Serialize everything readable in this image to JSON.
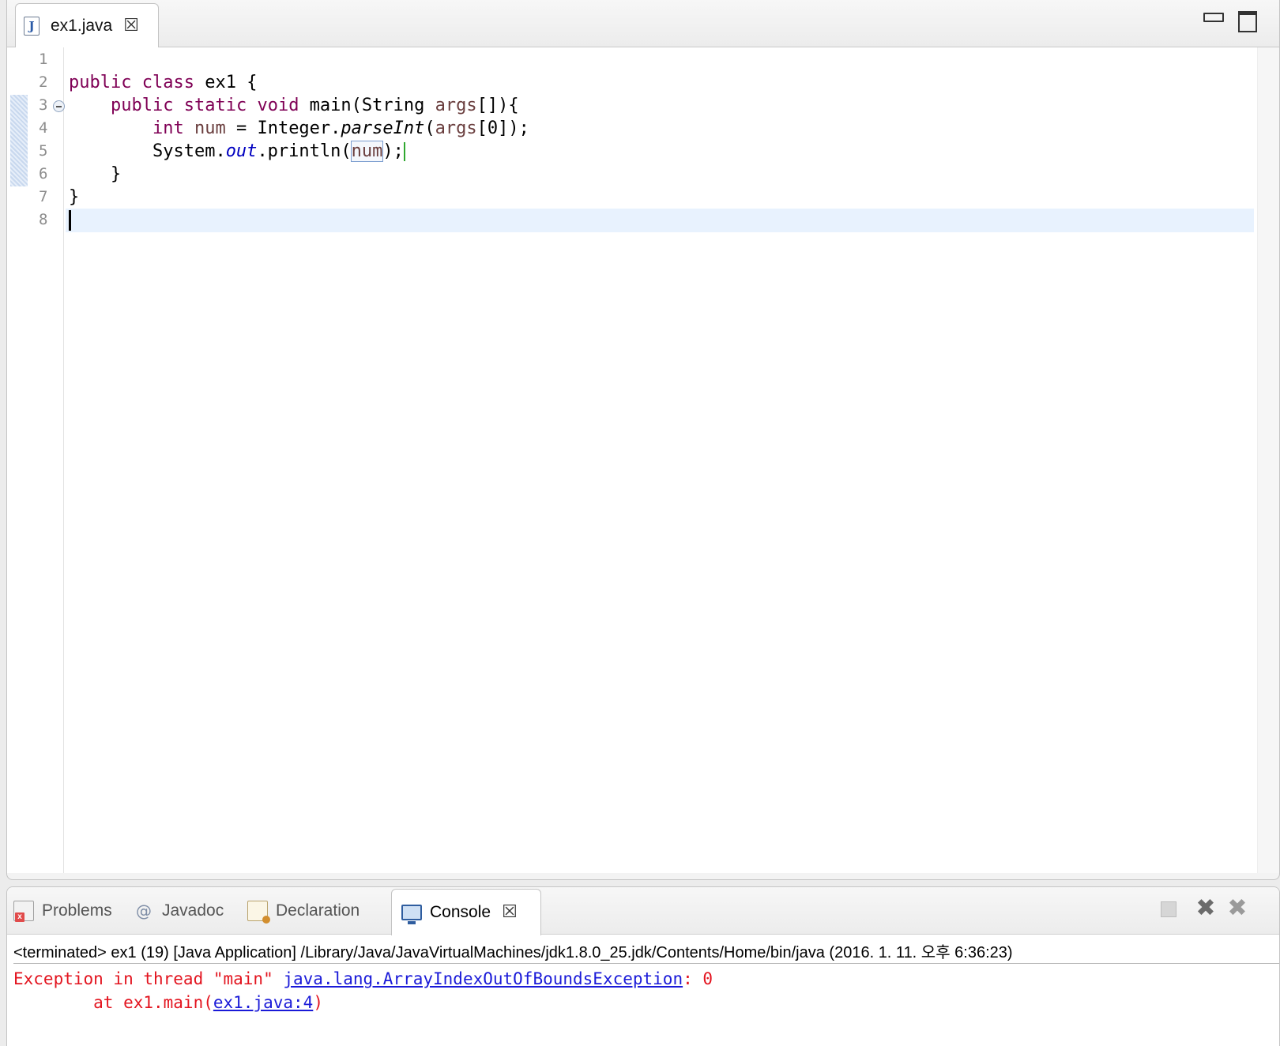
{
  "editor": {
    "tab_label": "ex1.java",
    "file_icon_glyph": "J",
    "close_glyph": "☒",
    "line_numbers": [
      "1",
      "2",
      "3",
      "4",
      "5",
      "6",
      "7",
      "8"
    ],
    "code": {
      "line2": {
        "kw1": "public",
        "kw2": "class",
        "rest": " ex1 {"
      },
      "line3": {
        "kw1": "public",
        "kw2": "static",
        "kw3": "void",
        "mid": " main(String ",
        "var": "args",
        "end": "[]){"
      },
      "line4": {
        "kw": "int",
        "var": "num",
        "eq": " = Integer.",
        "method": "parseInt",
        "open": "(",
        "arg": "args",
        "end": "[0]);"
      },
      "line5": {
        "cls": "System.",
        "field": "out",
        "call": ".println(",
        "var": "num",
        "end": ");"
      },
      "line6": "}",
      "line7": "}"
    }
  },
  "views": {
    "tabs": [
      {
        "label": "Problems",
        "icon": "problems-icon"
      },
      {
        "label": "Javadoc",
        "icon": "javadoc-icon",
        "glyph": "@"
      },
      {
        "label": "Declaration",
        "icon": "declaration-icon"
      },
      {
        "label": "Console",
        "icon": "console-icon",
        "active": true
      }
    ],
    "close_glyph": "☒",
    "remove_glyph": "✖",
    "console": {
      "header": "<terminated> ex1 (19) [Java Application] /Library/Java/JavaVirtualMachines/jdk1.8.0_25.jdk/Contents/Home/bin/java (2016. 1. 11. 오후 6:36:23)",
      "line1_prefix": "Exception in thread \"main\" ",
      "line1_link": "java.lang.ArrayIndexOutOfBoundsException",
      "line1_suffix": ": 0",
      "line2_prefix": "        at ex1.main(",
      "line2_link": "ex1.java:4",
      "line2_suffix": ")"
    }
  },
  "colors": {
    "keyword": "#7f0055",
    "local_variable": "#6a3e3e",
    "static_field": "#0000c0",
    "error_text": "#e3141f",
    "link": "#1a1ad8",
    "current_line": "#e8f2fe"
  }
}
